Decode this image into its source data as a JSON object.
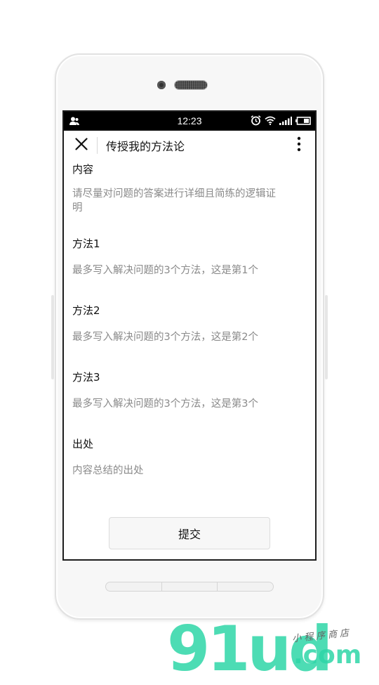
{
  "status_bar": {
    "time": "12:23"
  },
  "header": {
    "title": "传授我的方法论"
  },
  "form": {
    "fields": [
      {
        "label": "内容",
        "placeholder": "请尽量对问题的答案进行详细且简练的逻辑证明"
      },
      {
        "label": "方法1",
        "placeholder": "最多写入解决问题的3个方法，这是第1个"
      },
      {
        "label": "方法2",
        "placeholder": "最多写入解决问题的3个方法，这是第2个"
      },
      {
        "label": "方法3",
        "placeholder": "最多写入解决问题的3个方法，这是第3个"
      },
      {
        "label": "出处",
        "placeholder": "内容总结的出处"
      }
    ],
    "submit_label": "提交"
  },
  "watermark": {
    "main": "91ud",
    "domain": ".com",
    "subtitle": "小程序商店"
  },
  "icons": {
    "close": "close-icon",
    "more": "more-vertical-icon",
    "user": "user-icon",
    "alarm": "alarm-icon",
    "wifi": "wifi-icon",
    "signal": "signal-icon",
    "battery": "battery-icon"
  },
  "colors": {
    "watermark": "#2ed6a8",
    "placeholder": "#8a8a8a",
    "status_bar": "#000000"
  }
}
